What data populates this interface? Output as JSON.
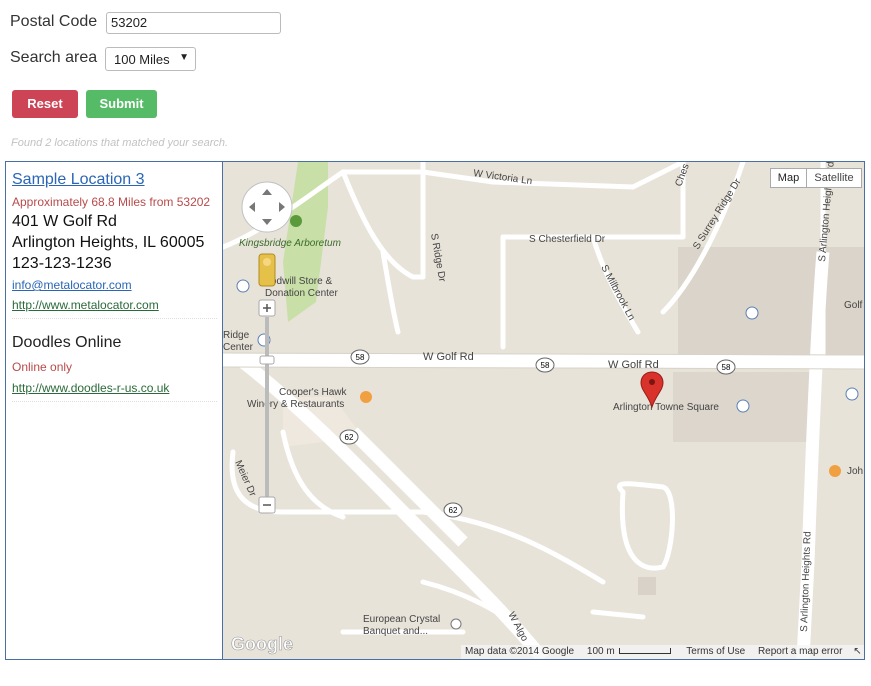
{
  "form": {
    "postal_label": "Postal Code",
    "postal_value": "53202",
    "area_label": "Search area",
    "area_value": "100 Miles",
    "reset_label": "Reset",
    "submit_label": "Submit",
    "found_message": "Found 2 locations that matched your search."
  },
  "locations": [
    {
      "title": "Sample Location 3",
      "distance": "Approximately 68.8 Miles from 53202",
      "address1": "401 W Golf Rd",
      "address2": "Arlington Heights, IL 60005",
      "phone": "123-123-1236",
      "email": "info@metalocator.com",
      "website": "http://www.metalocator.com"
    },
    {
      "title": "Doodles Online",
      "distance": "Online only",
      "website": "http://www.doodles-r-us.co.uk"
    }
  ],
  "map": {
    "type_map": "Map",
    "type_satellite": "Satellite",
    "labels": {
      "victoria": "W Victoria Ln",
      "chesterfield": "S Chesterfield Dr",
      "surrey": "S Surrey Ridge Dr",
      "ches": "Ches",
      "arlington_top": "S Arlington Heights Rd",
      "arlington_bottom": "S Arlington Heights Rd",
      "ridge_dr": "S Ridge Dr",
      "milbrook": "S Milbrook Ln",
      "arboretum": "Kingsbridge Arboretum",
      "goodwill1": "odwill Store &",
      "goodwill2": "Donation Center",
      "ridge_center1": "Ridge",
      "ridge_center2": "Center",
      "golf_left": "W Golf Rd",
      "golf_right": "W Golf Rd",
      "golf_edge": "Golf",
      "coopers1": "Cooper's Hawk",
      "coopers2": "Winery & Restaurants",
      "towne_square": "Arlington Towne Square",
      "joh": "Joh",
      "meier": "Meier Dr",
      "algonquin": "W Algo",
      "euro1": "European Crystal",
      "euro2": "Banquet and...",
      "shield58a": "58",
      "shield58b": "58",
      "shield58c": "58",
      "shield62a": "62",
      "shield62b": "62",
      "brand": "Google"
    },
    "footer": {
      "data": "Map data ©2014 Google",
      "scale": "100 m",
      "terms": "Terms of Use",
      "report": "Report a map error"
    }
  }
}
